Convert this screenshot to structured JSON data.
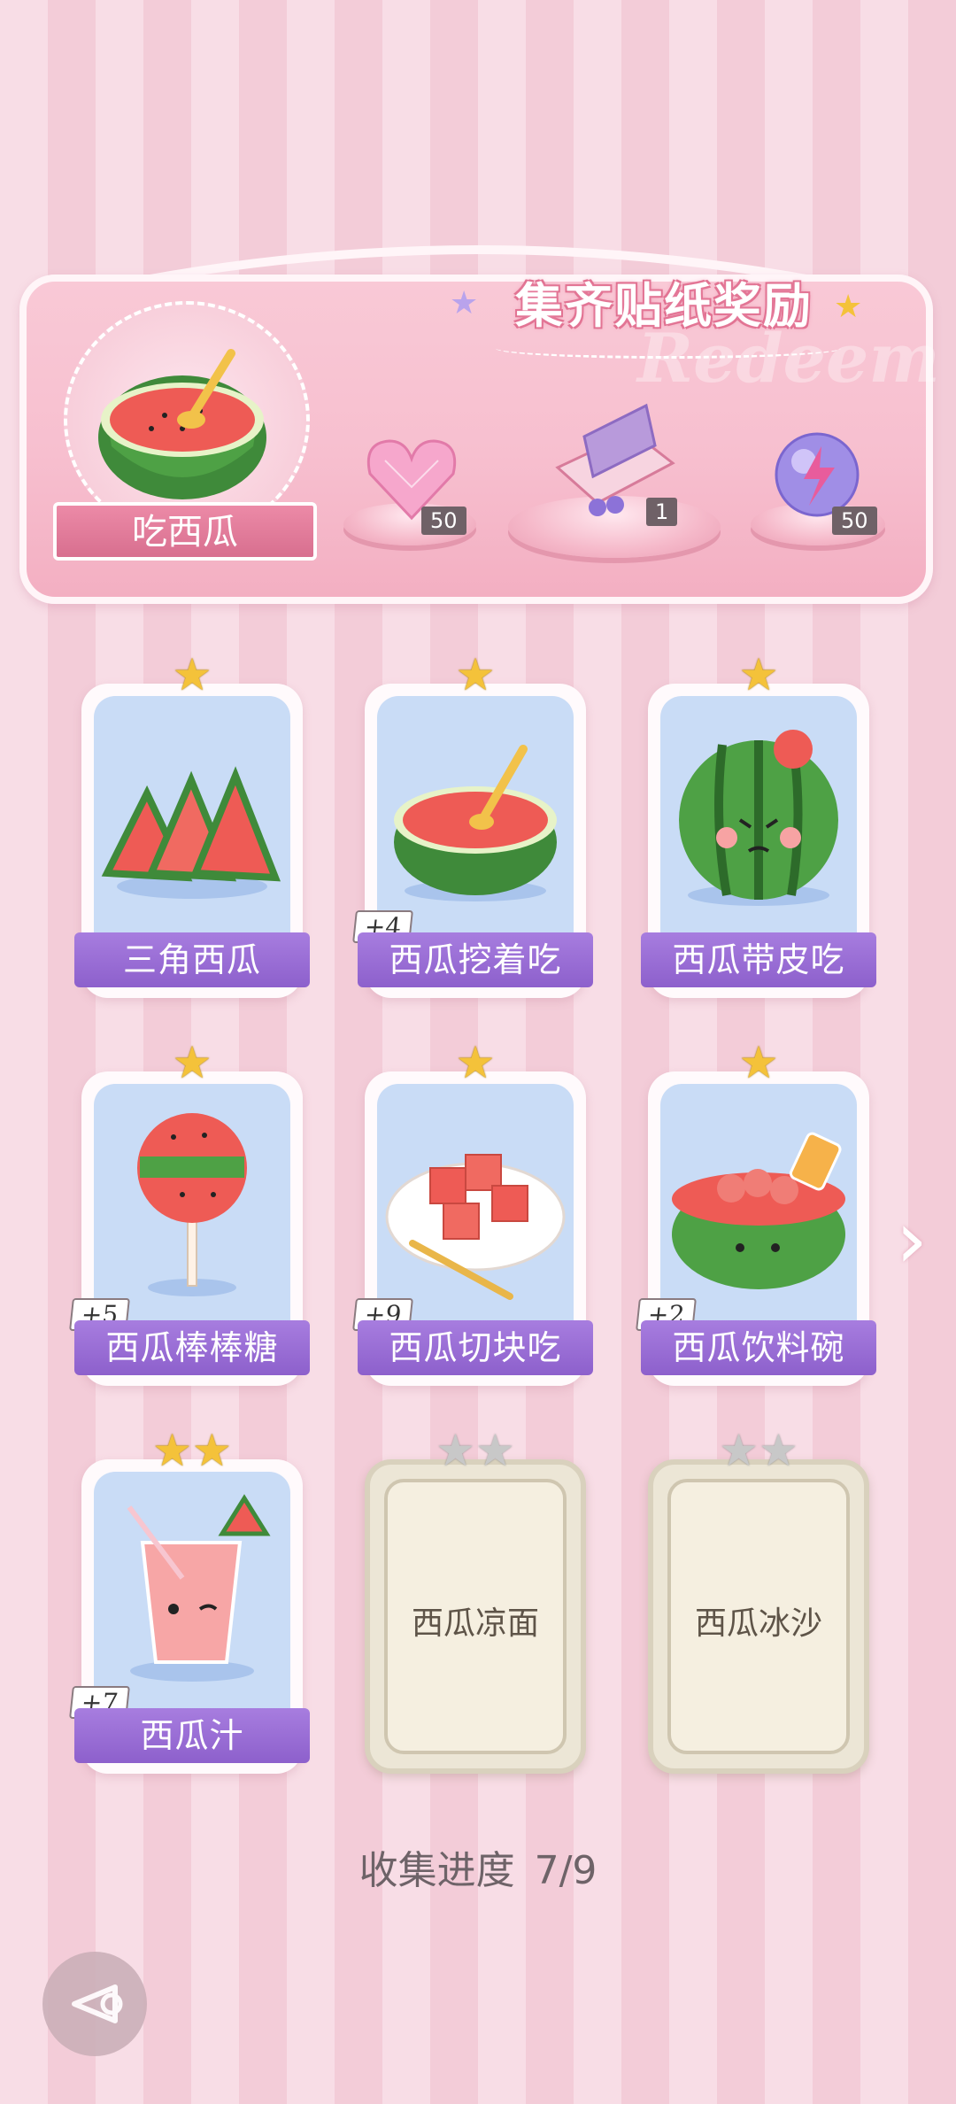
{
  "banner": {
    "title": "集齐贴纸奖励",
    "watermark": "Redeem",
    "main_label": "吃西瓜",
    "rewards": [
      {
        "icon": "pink-heart-gem-icon",
        "count": "50"
      },
      {
        "icon": "gift-box-icon",
        "count": "1"
      },
      {
        "icon": "lightning-orb-icon",
        "count": "50"
      }
    ]
  },
  "cards": [
    {
      "label": "三角西瓜",
      "stars": 1,
      "bonus": "",
      "icon": "watermelon-slices-icon"
    },
    {
      "label": "西瓜挖着吃",
      "stars": 1,
      "bonus": "+4",
      "icon": "watermelon-half-spoon-icon"
    },
    {
      "label": "西瓜带皮吃",
      "stars": 1,
      "bonus": "",
      "icon": "angry-watermelon-icon"
    },
    {
      "label": "西瓜棒棒糖",
      "stars": 1,
      "bonus": "+5",
      "icon": "watermelon-lollipop-icon"
    },
    {
      "label": "西瓜切块吃",
      "stars": 1,
      "bonus": "+9",
      "icon": "watermelon-cubes-icon"
    },
    {
      "label": "西瓜饮料碗",
      "stars": 1,
      "bonus": "+2",
      "icon": "watermelon-drink-bowl-icon"
    },
    {
      "label": "西瓜汁",
      "stars": 2,
      "bonus": "+7",
      "icon": "watermelon-juice-icon"
    }
  ],
  "locked_cards": [
    {
      "label": "西瓜凉面",
      "stars": 2
    },
    {
      "label": "西瓜冰沙",
      "stars": 2
    }
  ],
  "progress": {
    "label": "收集进度",
    "value": "7/9"
  },
  "colors": {
    "accent_purple": "#9a6fd8",
    "star_gold": "#f4c23a",
    "banner_pink": "#f7bfcf"
  }
}
